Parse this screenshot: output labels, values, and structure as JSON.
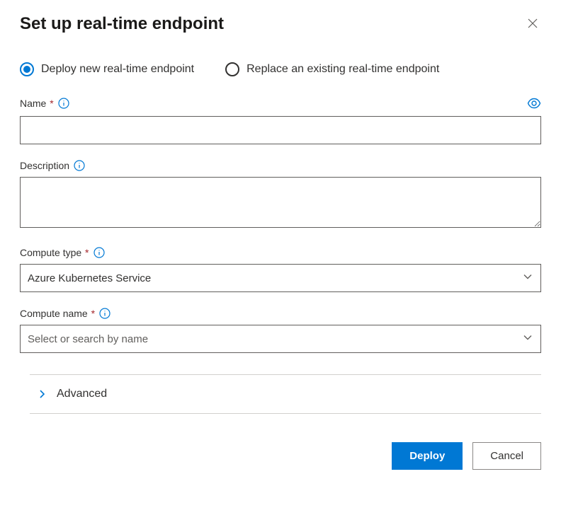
{
  "header": {
    "title": "Set up real-time endpoint"
  },
  "radio": {
    "deploy_new": "Deploy new real-time endpoint",
    "replace_existing": "Replace an existing real-time endpoint"
  },
  "fields": {
    "name": {
      "label": "Name",
      "value": ""
    },
    "description": {
      "label": "Description",
      "value": ""
    },
    "compute_type": {
      "label": "Compute type",
      "value": "Azure Kubernetes Service"
    },
    "compute_name": {
      "label": "Compute name",
      "placeholder": "Select or search by name"
    }
  },
  "advanced": {
    "label": "Advanced"
  },
  "footer": {
    "deploy": "Deploy",
    "cancel": "Cancel"
  }
}
